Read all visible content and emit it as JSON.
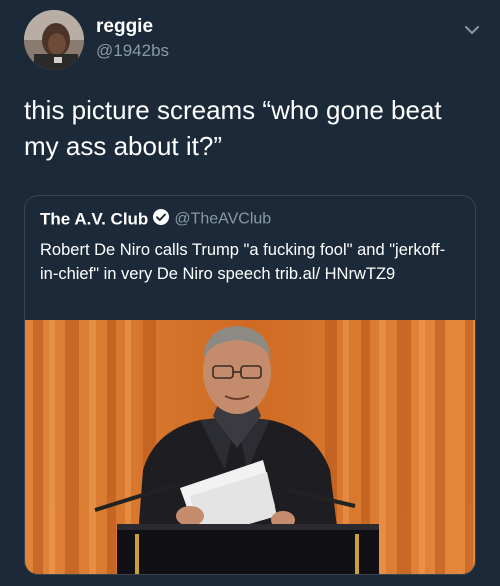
{
  "tweet": {
    "display_name": "reggie",
    "handle": "@1942bs",
    "text": "this picture screams “who gone beat my ass about it?”"
  },
  "quoted_tweet": {
    "display_name": "The A.V. Club",
    "handle": "@TheAVClub",
    "text": "Robert De Niro calls Trump \"a fucking fool\" and \"jerkoff-in-chief\" in very De Niro speech trib.al/ HNrwTZ9"
  },
  "icons": {
    "menu": "chevron-down-icon",
    "verified": "verified-badge-icon"
  },
  "colors": {
    "background": "#1c2938",
    "secondary_text": "#8899a6",
    "border": "#38444d",
    "curtain": "#d9742a"
  }
}
